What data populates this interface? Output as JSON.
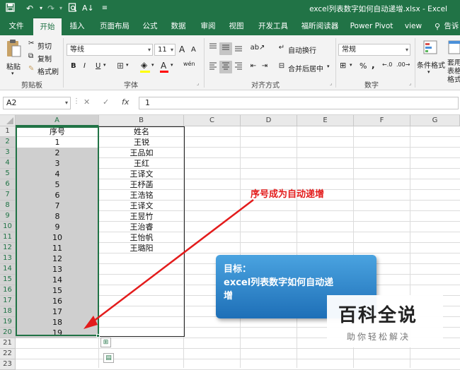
{
  "titlebar": {
    "save_icon": "save-icon",
    "undo_icon": "undo-icon",
    "redo_icon": "redo-icon",
    "preview_icon": "print-preview-icon",
    "sort_icon": "sort-az-icon",
    "customize_icon": "customize-quick-access-icon",
    "title": "excel列表数字如何自动递增.xlsx  -  Excel"
  },
  "tabs": [
    "文件",
    "开始",
    "插入",
    "页面布局",
    "公式",
    "数据",
    "审阅",
    "视图",
    "开发工具",
    "福昕阅读器",
    "Power Pivot",
    "view",
    "告诉"
  ],
  "active_tab": "开始",
  "tell_me_icon": "lightbulb-icon",
  "ribbon": {
    "clipboard": {
      "paste": "粘贴",
      "cut": "剪切",
      "copy": "复制",
      "format_painter": "格式刷",
      "group": "剪贴板"
    },
    "font": {
      "name": "等线",
      "size": "11",
      "grow": "A",
      "shrink": "A",
      "bold": "B",
      "italic": "I",
      "underline": "U",
      "font_color_glyph": "A",
      "phonetic": "wén",
      "group": "字体"
    },
    "alignment": {
      "wrap": "自动换行",
      "merge": "合并后居中",
      "group": "对齐方式"
    },
    "number": {
      "format": "常规",
      "percent": "%",
      "comma": ",",
      "group": "数字"
    },
    "styles": {
      "conditional": "条件格式",
      "table": "套用表格格式"
    }
  },
  "formula_bar": {
    "name_box": "A2",
    "cancel": "✕",
    "enter": "✓",
    "fx": "fx",
    "value": "1"
  },
  "sheet": {
    "columns": [
      "A",
      "B",
      "C",
      "D",
      "E",
      "F",
      "G"
    ],
    "selected_column": "A",
    "rows": [
      "1",
      "2",
      "3",
      "4",
      "5",
      "6",
      "7",
      "8",
      "9",
      "10",
      "11",
      "12",
      "13",
      "14",
      "15",
      "16",
      "17",
      "18",
      "19",
      "20",
      "21",
      "22",
      "23"
    ],
    "header_a": "序号",
    "header_b": "姓名",
    "col_a": [
      "1",
      "2",
      "3",
      "4",
      "5",
      "6",
      "7",
      "8",
      "9",
      "10",
      "11",
      "12",
      "13",
      "14",
      "15",
      "16",
      "17",
      "18",
      "19"
    ],
    "col_b": [
      "王锐",
      "王品如",
      "王红",
      "王译文",
      "王杼菡",
      "王浩铭",
      "王译文",
      "王昱竹",
      "王治睿",
      "王怡帆",
      "王璐阳"
    ]
  },
  "annotation": "序号成为自动递增",
  "goal": {
    "line1": "目标：",
    "line2": "excel列表数字如何自动递",
    "line3": "增"
  },
  "watermark": {
    "title": "百科全说",
    "subtitle": "助你轻松解决"
  },
  "colors": {
    "excel_green": "#217346",
    "annotation_red": "#e31c1c",
    "goal_blue": "#1e6fb7",
    "selection_gray": "#cfcfcf"
  }
}
